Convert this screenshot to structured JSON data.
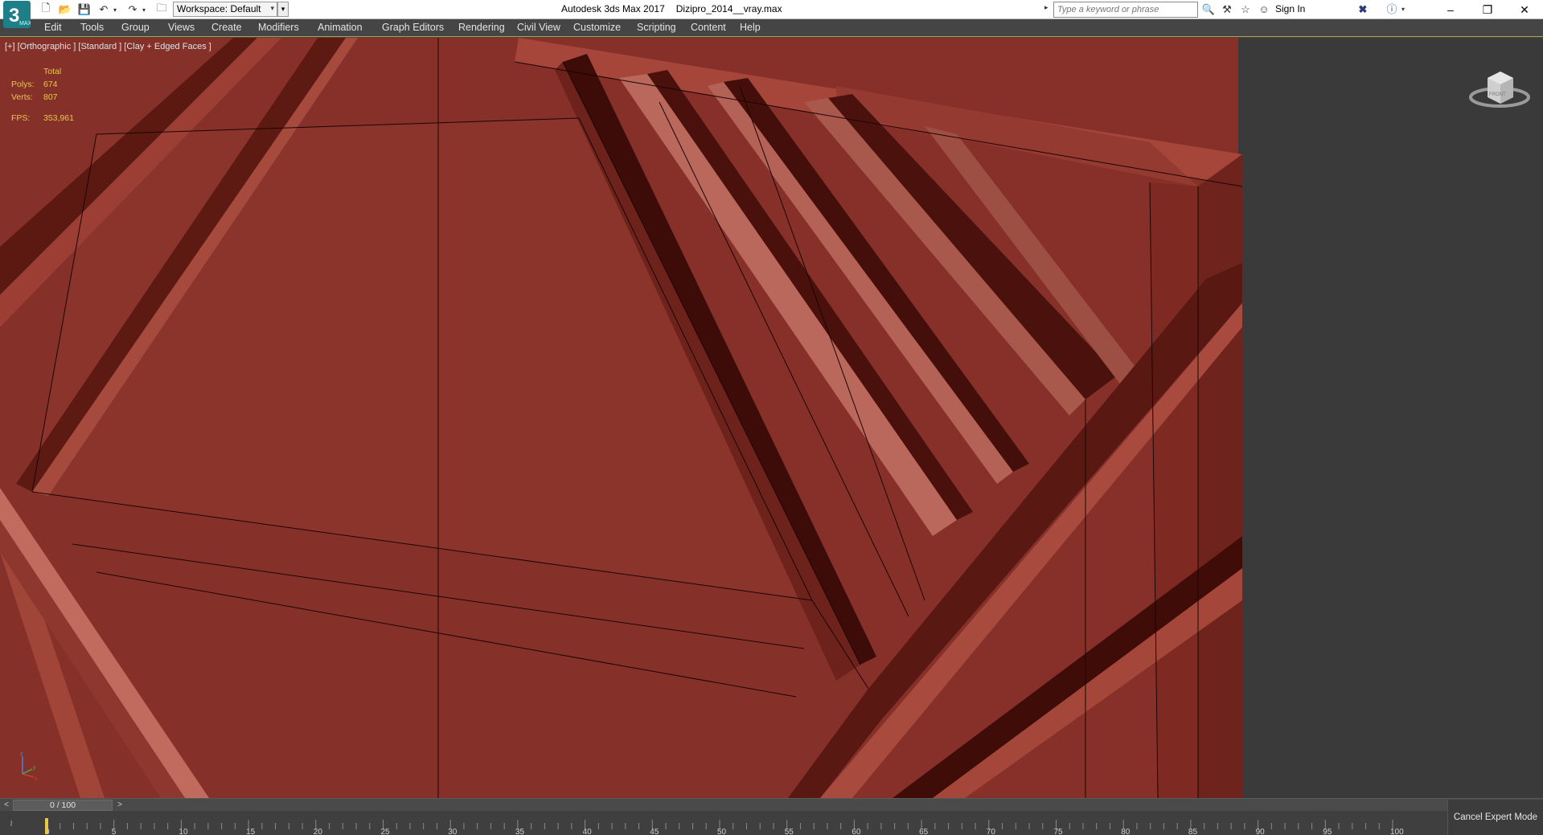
{
  "titlebar": {
    "app_name": "Autodesk 3ds Max 2017",
    "file_name": "Dizipro_2014__vray.max",
    "workspace_label": "Workspace: Default",
    "search_placeholder": "Type a keyword or phrase",
    "sign_in": "Sign In",
    "icons": [
      "new-file-icon",
      "open-file-icon",
      "save-icon",
      "undo-icon",
      "redo-icon",
      "project-folder-icon",
      "binoculars-icon",
      "exchange-icon",
      "star-icon",
      "user-icon",
      "autodesk-x-icon",
      "help-icon"
    ]
  },
  "menu": {
    "items": [
      "Edit",
      "Tools",
      "Group",
      "Views",
      "Create",
      "Modifiers",
      "Animation",
      "Graph Editors",
      "Rendering",
      "Civil View",
      "Customize",
      "Scripting",
      "Content",
      "Help"
    ]
  },
  "viewport": {
    "label": "[+] [Orthographic ] [Standard ] [Clay + Edged Faces ]",
    "stats": {
      "total_label": "Total",
      "polys_label": "Polys:",
      "polys": "674",
      "verts_label": "Verts:",
      "verts": "807",
      "fps_label": "FPS:",
      "fps": "353,961"
    },
    "viewcube_label": "FRONT",
    "colors": {
      "clay": "#8a3229",
      "clay_light": "#a8463b",
      "clay_dark": "#5e1a14",
      "groove": "#3a0b08",
      "background": "#3a3a3a",
      "stats_yellow": "#e8c84a"
    }
  },
  "timeline": {
    "frame_display": "0 / 100",
    "prev_label": "<",
    "next_label": ">",
    "ticks": [
      "0",
      "5",
      "10",
      "15",
      "20",
      "25",
      "30",
      "35",
      "40",
      "45",
      "50",
      "55",
      "60",
      "65",
      "70",
      "75",
      "80",
      "85",
      "90",
      "95",
      "100"
    ],
    "cancel_expert": "Cancel Expert Mode"
  }
}
